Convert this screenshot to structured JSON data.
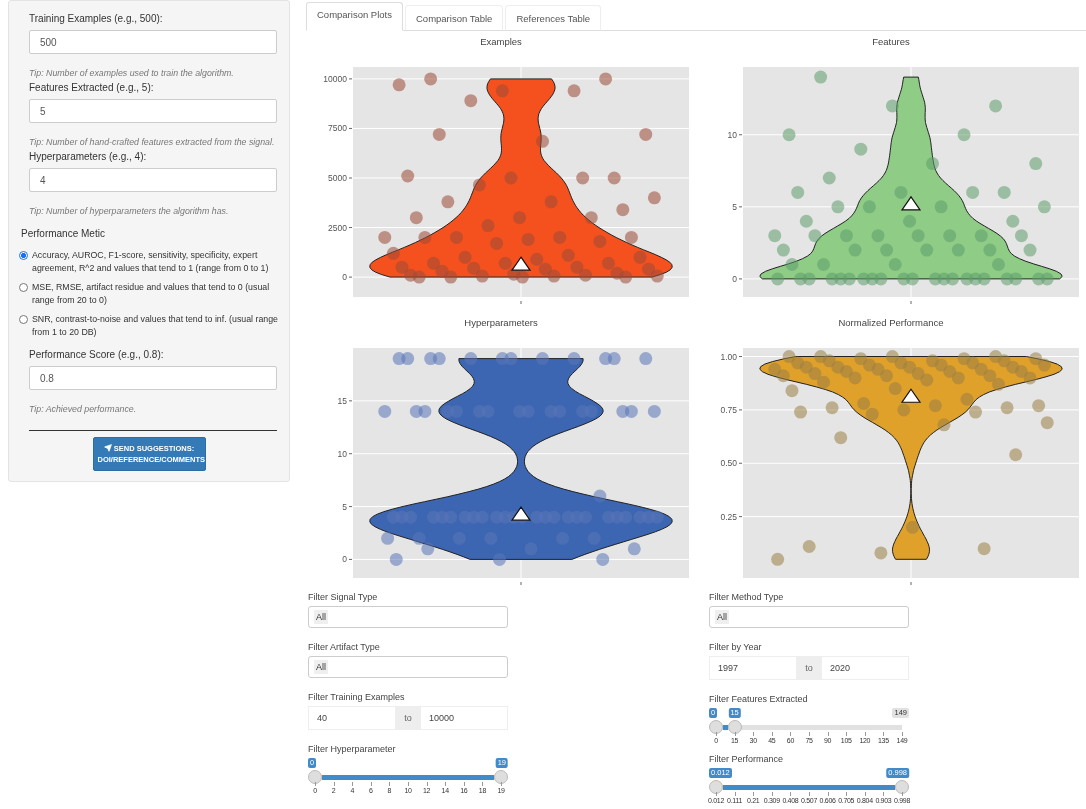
{
  "sidebar": {
    "fields": [
      {
        "label": "Training Examples (e.g., 500):",
        "value": "500",
        "tip": "Tip: Number of examples used to train the algorithm."
      },
      {
        "label": "Features Extracted (e.g., 5):",
        "value": "5",
        "tip": "Tip: Number of hand-crafted features extracted from the signal."
      },
      {
        "label": "Hyperparameters (e.g., 4):",
        "value": "4",
        "tip": "Tip: Number of hyperparameters the algorithm has."
      }
    ],
    "metric": {
      "label": "Performance Metic",
      "options": [
        {
          "label": "Accuracy, AUROC, F1-score, sensitivity, specificity, expert agreement, R^2 and values that tend to 1 (range from 0 to 1)",
          "selected": true
        },
        {
          "label": "MSE, RMSE, artifact residue and values that tend to 0 (usual range from 20 to 0)",
          "selected": false
        },
        {
          "label": "SNR, contrast-to-noise and values that tend to inf. (usual range from 1 to 20 DB)",
          "selected": false
        }
      ]
    },
    "score_field": {
      "label": "Performance Score (e.g., 0.8):",
      "value": "0.8",
      "tip": "Tip: Achieved performance."
    },
    "button": "SEND SUGGESTIONS: DOI/REFERENCE/COMMENTS"
  },
  "tabs": [
    {
      "label": "Comparison Plots",
      "selected": true
    },
    {
      "label": "Comparison Table",
      "selected": false
    },
    {
      "label": "References Table",
      "selected": false
    }
  ],
  "charts": [
    {
      "title": "Examples",
      "color": "#f4511e",
      "y_labels": [
        "10000",
        "7500",
        "5000",
        "2500",
        "0"
      ]
    },
    {
      "title": "Features",
      "color": "#8fcc86",
      "y_labels": [
        "10",
        "5",
        "0"
      ]
    },
    {
      "title": "Hyperparameters",
      "color": "#3c66b1",
      "y_labels": [
        "15",
        "10",
        "5",
        "0"
      ]
    },
    {
      "title": "Normalized Performance",
      "color": "#e0a12a",
      "y_labels": [
        "1.00",
        "0.75",
        "0.50",
        "0.25"
      ]
    }
  ],
  "filters": {
    "left": [
      {
        "kind": "select",
        "label": "Filter Signal Type",
        "chips": [
          "All"
        ]
      },
      {
        "kind": "select",
        "label": "Filter Artifact Type",
        "chips": [
          "All"
        ]
      },
      {
        "kind": "range",
        "label": "Filter Training Examples",
        "from": "40",
        "sep": "to",
        "to": "10000"
      },
      {
        "kind": "slider",
        "label": "Filter Hyperparameter",
        "thumbs": [
          {
            "label": "0",
            "level": 0
          },
          {
            "label": "19",
            "level": 1
          }
        ],
        "ticks": [
          "0",
          "2",
          "4",
          "6",
          "8",
          "10",
          "12",
          "14",
          "16",
          "18",
          "19"
        ]
      }
    ],
    "right": [
      {
        "kind": "select",
        "label": "Filter Method Type",
        "chips": [
          "All"
        ]
      },
      {
        "kind": "range",
        "label": "Filter by Year",
        "from": "1997",
        "sep": "to",
        "to": "2020"
      },
      {
        "kind": "slider",
        "label": "Filter Features Extracted",
        "thumbs": [
          {
            "label": "0",
            "level": 0
          },
          {
            "label": "15",
            "level": 0.1
          }
        ],
        "max_label": "149",
        "ticks": [
          "0",
          "15",
          "30",
          "45",
          "60",
          "75",
          "90",
          "105",
          "120",
          "135",
          "149"
        ]
      },
      {
        "kind": "slider",
        "label": "Filter Performance",
        "thumbs": [
          {
            "label": "0.012",
            "level": 0
          },
          {
            "label": "0.998",
            "level": 1
          }
        ],
        "ticks": [
          "0.012",
          "0.111",
          "0.21",
          "0.309",
          "0.408",
          "0.507",
          "0.606",
          "0.705",
          "0.804",
          "0.903",
          "0.998"
        ]
      }
    ]
  }
}
